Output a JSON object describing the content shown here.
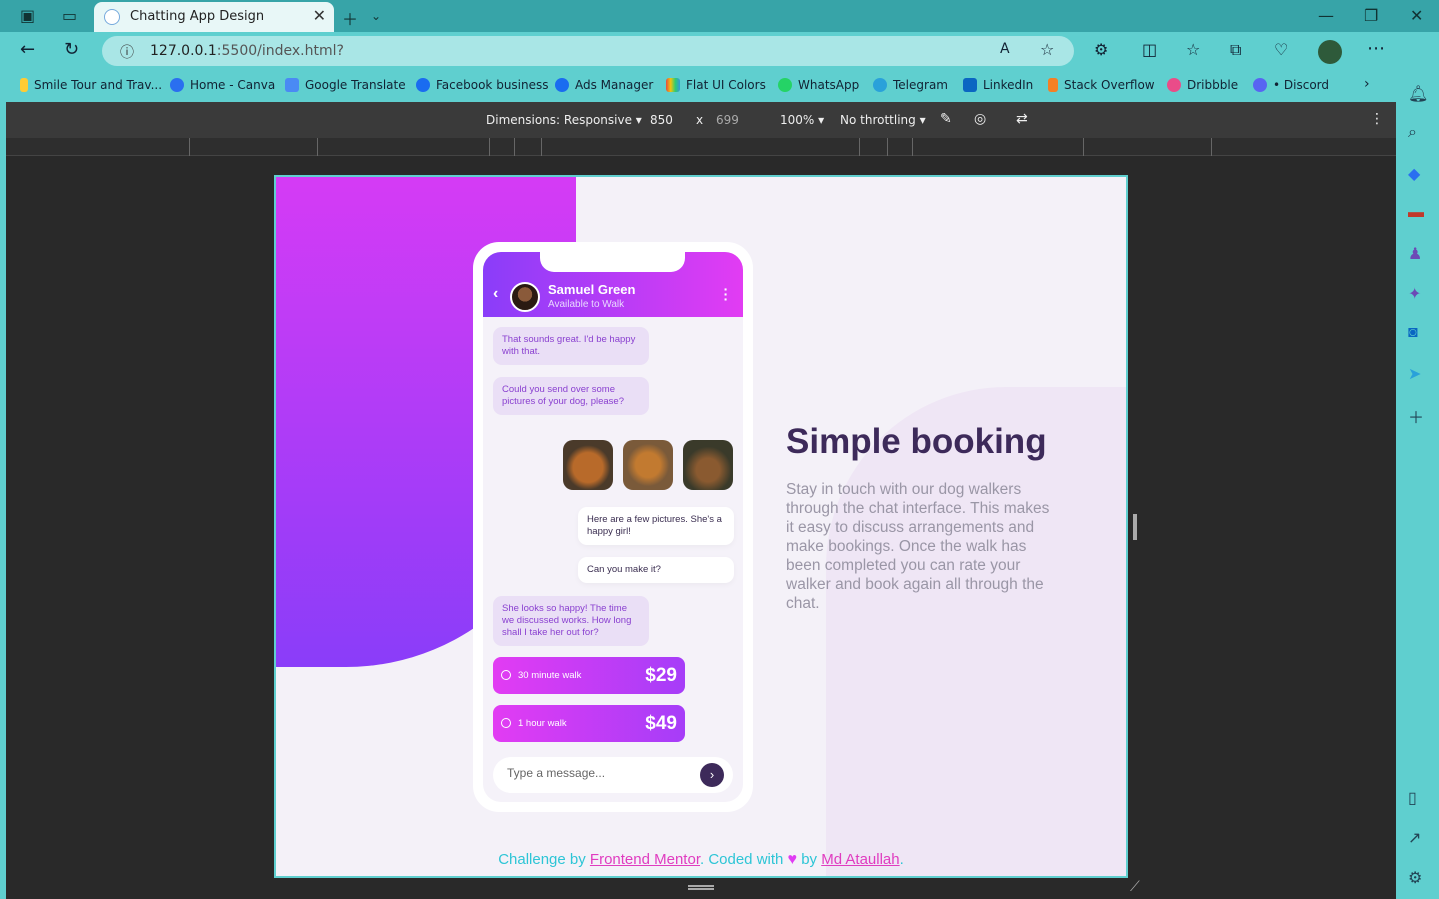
{
  "browser": {
    "tab_title": "Chatting App Design",
    "url_host": "127.0.0.1",
    "url_rest": ":5500/index.html?",
    "bookmarks": [
      "Smile Tour and Trav...",
      "Home - Canva",
      "Google Translate",
      "Facebook business",
      "Ads Manager",
      "Flat UI Colors",
      "WhatsApp",
      "Telegram",
      "LinkedIn",
      "Stack Overflow",
      "Dribbble",
      "• Discord"
    ]
  },
  "devtools": {
    "dimensions": "Dimensions: Responsive",
    "width": "850",
    "times": "x",
    "height": "699",
    "zoom": "100%",
    "throttling": "No throttling"
  },
  "chat": {
    "contact_name": "Samuel Green",
    "contact_status": "Available to Walk",
    "messages": [
      "That sounds great. I'd be happy with that.",
      "Could you send over some pictures of your dog, please?",
      "Here are a few pictures. She's a happy girl!",
      "Can you make it?",
      "She looks so happy! The time we discussed works. How long shall I take her out for?"
    ],
    "offers": [
      {
        "label": "30 minute walk",
        "price": "$29"
      },
      {
        "label": "1 hour walk",
        "price": "$49"
      }
    ],
    "input_placeholder": "Type a message..."
  },
  "intro": {
    "title": "Simple booking",
    "text": "Stay in touch with our dog walkers through the chat interface. This makes it easy to discuss arrangements and make bookings. Once the walk has been completed you can rate your walker and book again all through the chat."
  },
  "footer": {
    "prefix": "Challenge by",
    "link1": "Frontend Mentor",
    "middle": ". Coded with",
    "by": "by",
    "link2": "Md Ataullah",
    "suffix": "."
  },
  "colors": {
    "accent_purple": "#8a3df9",
    "accent_pink": "#e23cf3",
    "dark_text": "#3d2a5a",
    "footer_cyan": "#2dc5d6"
  }
}
